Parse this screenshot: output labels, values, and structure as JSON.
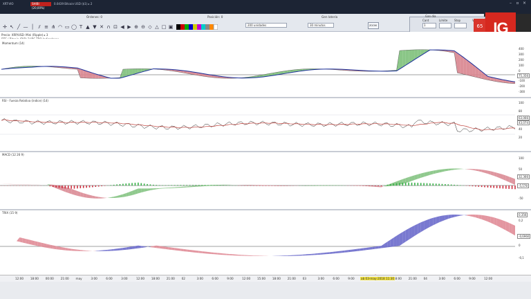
{
  "window": {
    "title": "XRT-VIO",
    "badge": "SHIBI (20,00%)",
    "detail": "0.0439 Bitcoin USD ($1) ▸ 2"
  },
  "toolbar": {
    "ordenes_label": "Órdenes: 0",
    "posicion_label": "Posición: 0",
    "gestionar_label": "Gen lotería",
    "units_value": "200 unidades",
    "interval_value": "30 minutos",
    "zoom_icon_label": "ZOOM"
  },
  "order_panel": {
    "title": "Gan dia",
    "cant_label": "Cant",
    "limite_label": "Límite",
    "stop_label": "Stop",
    "vender_label": "Vender",
    "cant_value": "1",
    "sell_value": "65"
  },
  "chart": {
    "ticker": "Precio: XRP/USD: Mini (Ripple) ▸ 3",
    "ticker2": "BTC / Bitcoin (DIR) 2HRS TBQ Indicadores",
    "panes": [
      {
        "label": "Momentum (14)",
        "ticks": [
          "400",
          "300",
          "200",
          "100",
          "0",
          "-100",
          "-200",
          "-300"
        ],
        "tag": "75,356"
      },
      {
        "label": "RSI - Fuerza Relativa (índice) (14)",
        "ticks": [
          "100",
          "80",
          "60",
          "40",
          "20"
        ],
        "tag": "63,066",
        "tag2": "43,074"
      },
      {
        "label": "MACD (12 26 9)",
        "ticks": [
          "100",
          "50",
          "0",
          "-50"
        ],
        "tag": "32,366",
        "tag2": "-5,578"
      },
      {
        "label": "TRIX (15 9)",
        "ticks": [
          "0,2",
          "0,1",
          "0",
          "-0,1"
        ],
        "tag": "0,356",
        "tag2": "-0,6960"
      }
    ],
    "x_ticks": [
      "12:00",
      "18:00",
      "00:00",
      "21:00",
      "may",
      "3:00",
      "6:00",
      "3:00",
      "12:00",
      "18:00",
      "21:00",
      "02",
      "3:00",
      "6:00",
      "9:00",
      "12:00",
      "15:00",
      "18:00",
      "21:00",
      "03",
      "3:00",
      "6:00",
      "9:00",
      "12:00",
      "15:00",
      "18:00",
      "21:00",
      "04",
      "3:00",
      "6:00",
      "9:00",
      "12:00"
    ],
    "x_highlight": "ab 03-may-2018 11:30",
    "colors": {
      "up_fill": "#7dc07a",
      "down_fill": "#d8848e",
      "main_line": "#1a2f9a",
      "rsi_signal": "#c0403a",
      "macd_hist_up": "#38b048",
      "macd_hist_down": "#cc3040",
      "trix_up": "#6a6acb",
      "trix_down": "#e08b96"
    }
  }
}
